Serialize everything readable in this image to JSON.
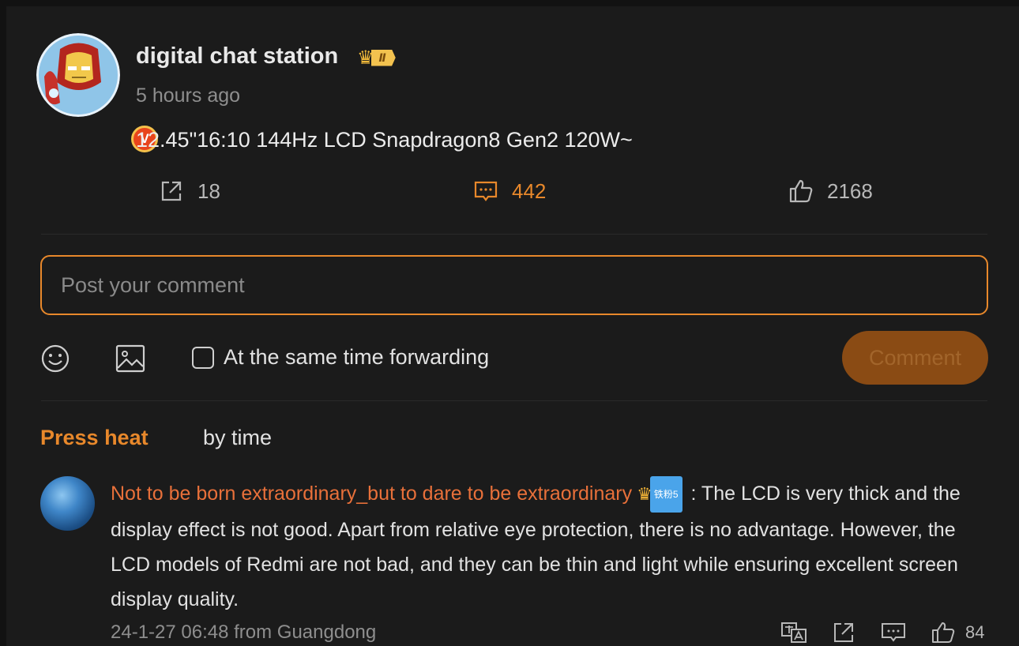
{
  "post": {
    "username": "digital chat station",
    "vip_level": "Ⅱ",
    "verified_label": "V",
    "time": "5 hours ago",
    "text": "12.45\"16:10 144Hz LCD Snapdragon8 Gen2 120W~",
    "forwards": "18",
    "comments": "442",
    "likes": "2168"
  },
  "composer": {
    "placeholder": "Post your comment",
    "forward_label": "At the same time forwarding",
    "submit_label": "Comment"
  },
  "sort": {
    "heat_label": "Press heat",
    "time_label": "by time"
  },
  "comments": [
    {
      "author": "Not to be born extraordinary_but to dare to be extraordinary",
      "fan_badge": "铁粉5",
      "separator": " : ",
      "text": "The LCD is very thick and the display effect is not good. Apart from relative eye protection, there is no advantage. However, the LCD models of Redmi are not bad, and they can be thin and light while ensuring excellent screen display quality.",
      "meta": "24-1-27 06:48 from Guangdong",
      "likes": "84"
    }
  ],
  "colors": {
    "accent": "#e8882b",
    "author": "#e8703a",
    "background": "#1b1b1b"
  }
}
